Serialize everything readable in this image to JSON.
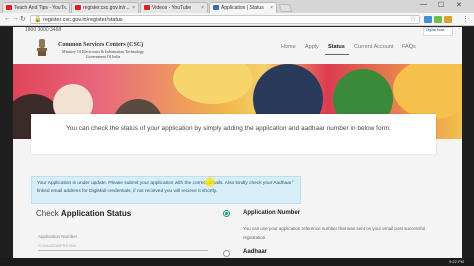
{
  "browser": {
    "tabs": [
      {
        "title": "Teach And Tips - YouT...",
        "active": false,
        "favicon_color": "#e02020"
      },
      {
        "title": "register.csc.gov.in/r...",
        "active": false,
        "favicon_color": "#e02020"
      },
      {
        "title": "Videos - YouTube",
        "active": false,
        "favicon_color": "#e02020"
      },
      {
        "title": "Application | Status",
        "active": true,
        "favicon_color": "#3a6ea5"
      }
    ],
    "url": "register.csc.gov.in/register/status",
    "window_controls": {
      "minimize": "—",
      "maximize": "☐",
      "close": "✕"
    }
  },
  "site": {
    "helpline": "1800 3000 3468",
    "org_title": "Common Services Centers (CSC)",
    "org_subtitle_1": "Ministry Of Electronics & Information Technology",
    "org_subtitle_2": "Government Of India",
    "nav": [
      {
        "label": "Home",
        "active": false
      },
      {
        "label": "Apply",
        "active": false
      },
      {
        "label": "Status",
        "active": true
      },
      {
        "label": "Current Account",
        "active": false
      },
      {
        "label": "FAQs",
        "active": false
      }
    ],
    "digital_badge": "Digital India"
  },
  "info": {
    "text": "You can check the status of your application by simply adding the application and aadhaar number in below form."
  },
  "alert": {
    "text": "Your Application is under update. Please submit your application with the correct details. Also kindly check your Aadhaar linked email address for DigiMail credentials, if not recieved you will recieve it shortly.",
    "close": "×"
  },
  "check": {
    "title_prefix": "Check",
    "title_bold": "Application Status",
    "app_label": "Application Number",
    "app_value": "GYAAG2OBPRSTAN",
    "option_selected": "Application Number",
    "option_other": "Aadhaar",
    "option_desc": "You can use your application reference number that was sent on your email post successful registration."
  },
  "taskbar": {
    "time": "5:22 PM"
  },
  "colors": {
    "accent": "#1a9a7a",
    "alert_bg": "#d7eef9"
  }
}
